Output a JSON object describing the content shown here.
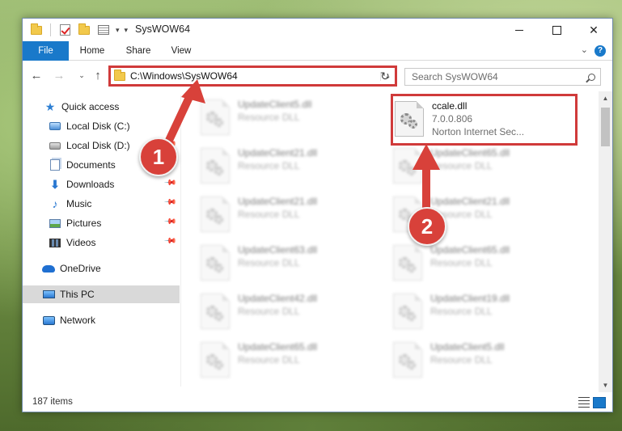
{
  "window": {
    "title": "SysWOW64",
    "controls": {
      "minimize": "",
      "maximize": "",
      "close": "✕"
    }
  },
  "ribbon": {
    "tabs": [
      "File",
      "Home",
      "Share",
      "View"
    ],
    "help": "?"
  },
  "nav": {
    "back": "←",
    "forward": "→",
    "recent": "⌄",
    "up": "↑",
    "address": "C:\\Windows\\SysWOW64",
    "address_dropdown": "⌄",
    "refresh": "↻",
    "search_placeholder": "Search SysWOW64"
  },
  "sidebar": {
    "items": [
      {
        "label": "Quick access",
        "icon": "star-icon"
      },
      {
        "label": "Local Disk (C:)",
        "icon": "drive-c-icon"
      },
      {
        "label": "Local Disk (D:)",
        "icon": "drive-d-icon"
      },
      {
        "label": "Documents",
        "icon": "documents-icon"
      },
      {
        "label": "Downloads",
        "icon": "downloads-icon"
      },
      {
        "label": "Music",
        "icon": "music-icon"
      },
      {
        "label": "Pictures",
        "icon": "pictures-icon"
      },
      {
        "label": "Videos",
        "icon": "videos-icon"
      },
      {
        "label": "OneDrive",
        "icon": "onedrive-icon"
      },
      {
        "label": "This PC",
        "icon": "this-pc-icon",
        "selected": true
      },
      {
        "label": "Network",
        "icon": "network-icon"
      }
    ],
    "pin": "📌"
  },
  "files": {
    "left": [
      {
        "name": "UpdateClient5.dll",
        "sub": "Resource DLL"
      },
      {
        "name": "UpdateClient21.dll",
        "sub": "Resource DLL"
      },
      {
        "name": "UpdateClient21.dll",
        "sub": "Resource DLL"
      },
      {
        "name": "UpdateClient63.dll",
        "sub": "Resource DLL"
      },
      {
        "name": "UpdateClient42.dll",
        "sub": "Resource DLL"
      },
      {
        "name": "UpdateClient65.dll",
        "sub": "Resource DLL"
      }
    ],
    "highlighted": {
      "name": "ccale.dll",
      "version": "7.0.0.806",
      "company": "Norton Internet Sec..."
    },
    "right": [
      {
        "name": "UpdateClient65.dll",
        "sub": "Resource DLL"
      },
      {
        "name": "UpdateClient21.dll",
        "sub": "Resource DLL"
      },
      {
        "name": "UpdateClient65.dll",
        "sub": "Resource DLL"
      },
      {
        "name": "UpdateClient19.dll",
        "sub": "Resource DLL"
      },
      {
        "name": "UpdateClient5.dll",
        "sub": "Resource DLL"
      }
    ]
  },
  "status": {
    "items_count": "187 items"
  },
  "annotations": {
    "step1": "1",
    "step2": "2",
    "accent": "#d8413a"
  }
}
